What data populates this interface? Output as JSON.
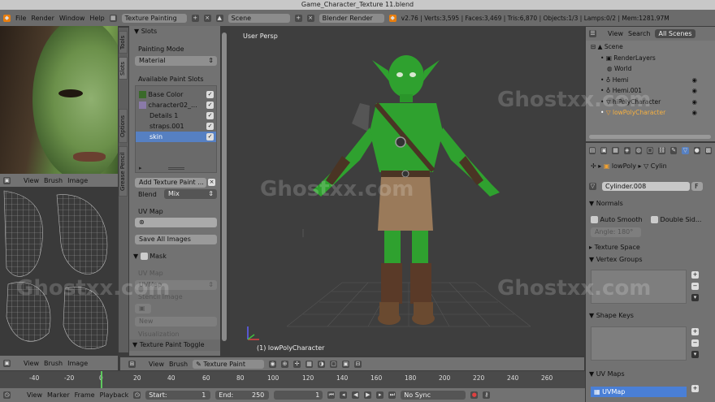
{
  "window": {
    "title": "Game_Character_Texture 11.blend"
  },
  "topbar": {
    "menus": [
      "File",
      "Render",
      "Window",
      "Help"
    ],
    "layout": "Texture Painting",
    "scene": "Scene",
    "engine": "Blender Render",
    "stats": "v2.76 | Verts:3,595 | Faces:3,469 | Tris:6,870 | Objects:1/3 | Lamps:0/2 | Mem:1281.97M"
  },
  "image_editor": {
    "menus": [
      "View",
      "Brush",
      "Image"
    ]
  },
  "uv_editor": {
    "menus": [
      "View",
      "Brush",
      "Image"
    ]
  },
  "tool_tabs": [
    "Tools",
    "Slots",
    "Options",
    "Grease Pencil"
  ],
  "slots_panel": {
    "title": "Slots",
    "painting_mode_label": "Painting Mode",
    "painting_mode_value": "Material",
    "available_label": "Available Paint Slots",
    "slots": [
      "Base Color",
      "character02_...",
      "Details 1",
      "straps.001",
      "skin"
    ],
    "add_texture": "Add Texture Paint ...",
    "blend_label": "Blend",
    "blend_value": "Mix",
    "uvmap_label": "UV Map",
    "save_all": "Save All Images",
    "mask_label": "Mask",
    "mask_uvmap_label": "UV Map",
    "mask_uvmap_value": "UVMap",
    "stencil_image": "Stencil Image",
    "new_label": "New",
    "visualization": "Visualization",
    "texture_paint_toggle": "Texture Paint Toggle"
  },
  "viewport": {
    "label": "User Persp",
    "object_label": "(1) lowPolyCharacter",
    "menus": [
      "View",
      "Brush"
    ],
    "mode": "Texture Paint"
  },
  "outliner": {
    "menus": [
      "View",
      "Search"
    ],
    "filter": "All Scenes",
    "items": [
      "Scene",
      "RenderLayers",
      "World",
      "Hemi",
      "Hemi.001",
      "hiPolyCharacter",
      "lowPolyCharacter"
    ]
  },
  "properties": {
    "breadcrumb": [
      "lowPoly",
      "Cylin"
    ],
    "mesh_name": "Cylinder.008",
    "f_label": "F",
    "normals": "Normals",
    "auto_smooth": "Auto Smooth",
    "double_sided": "Double Sid...",
    "angle": "Angle: 180°",
    "texture_space": "Texture Space",
    "vertex_groups": "Vertex Groups",
    "shape_keys": "Shape Keys",
    "uv_maps": "UV Maps",
    "uvmap_item": "UVMap"
  },
  "timeline": {
    "ticks": [
      "-40",
      "-20",
      "0",
      "20",
      "40",
      "60",
      "80",
      "100",
      "120",
      "140",
      "160",
      "180",
      "200",
      "220",
      "240",
      "260"
    ],
    "menus": [
      "View",
      "Marker",
      "Frame",
      "Playback"
    ],
    "start": "Start:",
    "start_value": "1",
    "end": "End:",
    "end_value": "250",
    "current": "1",
    "sync": "No Sync"
  },
  "watermark": "Ghostxx.com",
  "colors": {
    "selected": "#5680c2",
    "uv_selected": "#4a7fd6",
    "character": "#2fa12f"
  }
}
